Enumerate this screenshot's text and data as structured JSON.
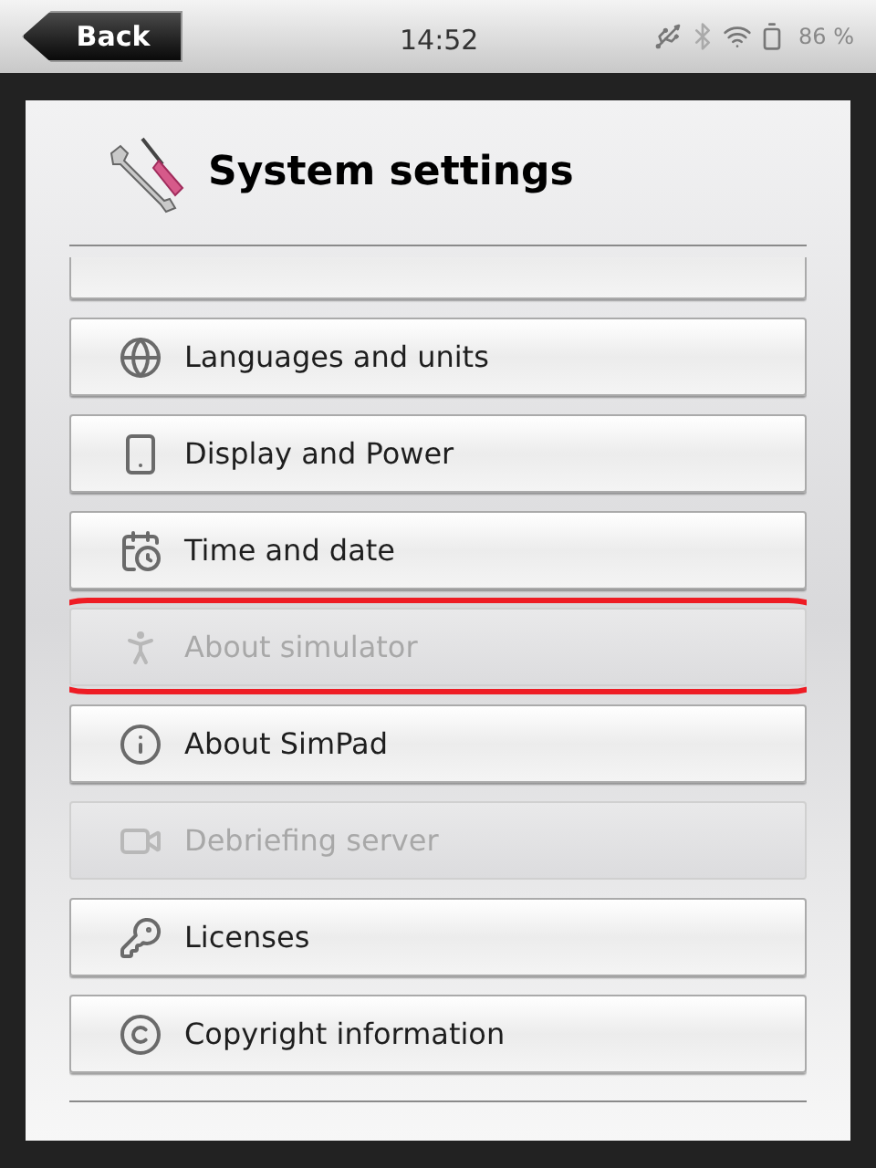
{
  "status_bar": {
    "back": "Back",
    "time": "14:52",
    "battery": "86 %"
  },
  "header": {
    "title": "System settings"
  },
  "items": [
    {
      "kind": "partial",
      "disabled": false,
      "annotated": false
    },
    {
      "kind": "globe",
      "label": "Languages and units",
      "disabled": false,
      "annotated": false
    },
    {
      "kind": "display",
      "label": "Display and Power",
      "disabled": false,
      "annotated": false
    },
    {
      "kind": "calendar",
      "label": "Time and date",
      "disabled": false,
      "annotated": false
    },
    {
      "kind": "person-info",
      "label": "About simulator",
      "disabled": true,
      "annotated": true
    },
    {
      "kind": "info",
      "label": "About SimPad",
      "disabled": false,
      "annotated": false
    },
    {
      "kind": "camera",
      "label": "Debriefing server",
      "disabled": true,
      "annotated": false
    },
    {
      "kind": "key",
      "label": "Licenses",
      "disabled": false,
      "annotated": false
    },
    {
      "kind": "copyright",
      "label": "Copyright information",
      "disabled": false,
      "annotated": false
    }
  ]
}
